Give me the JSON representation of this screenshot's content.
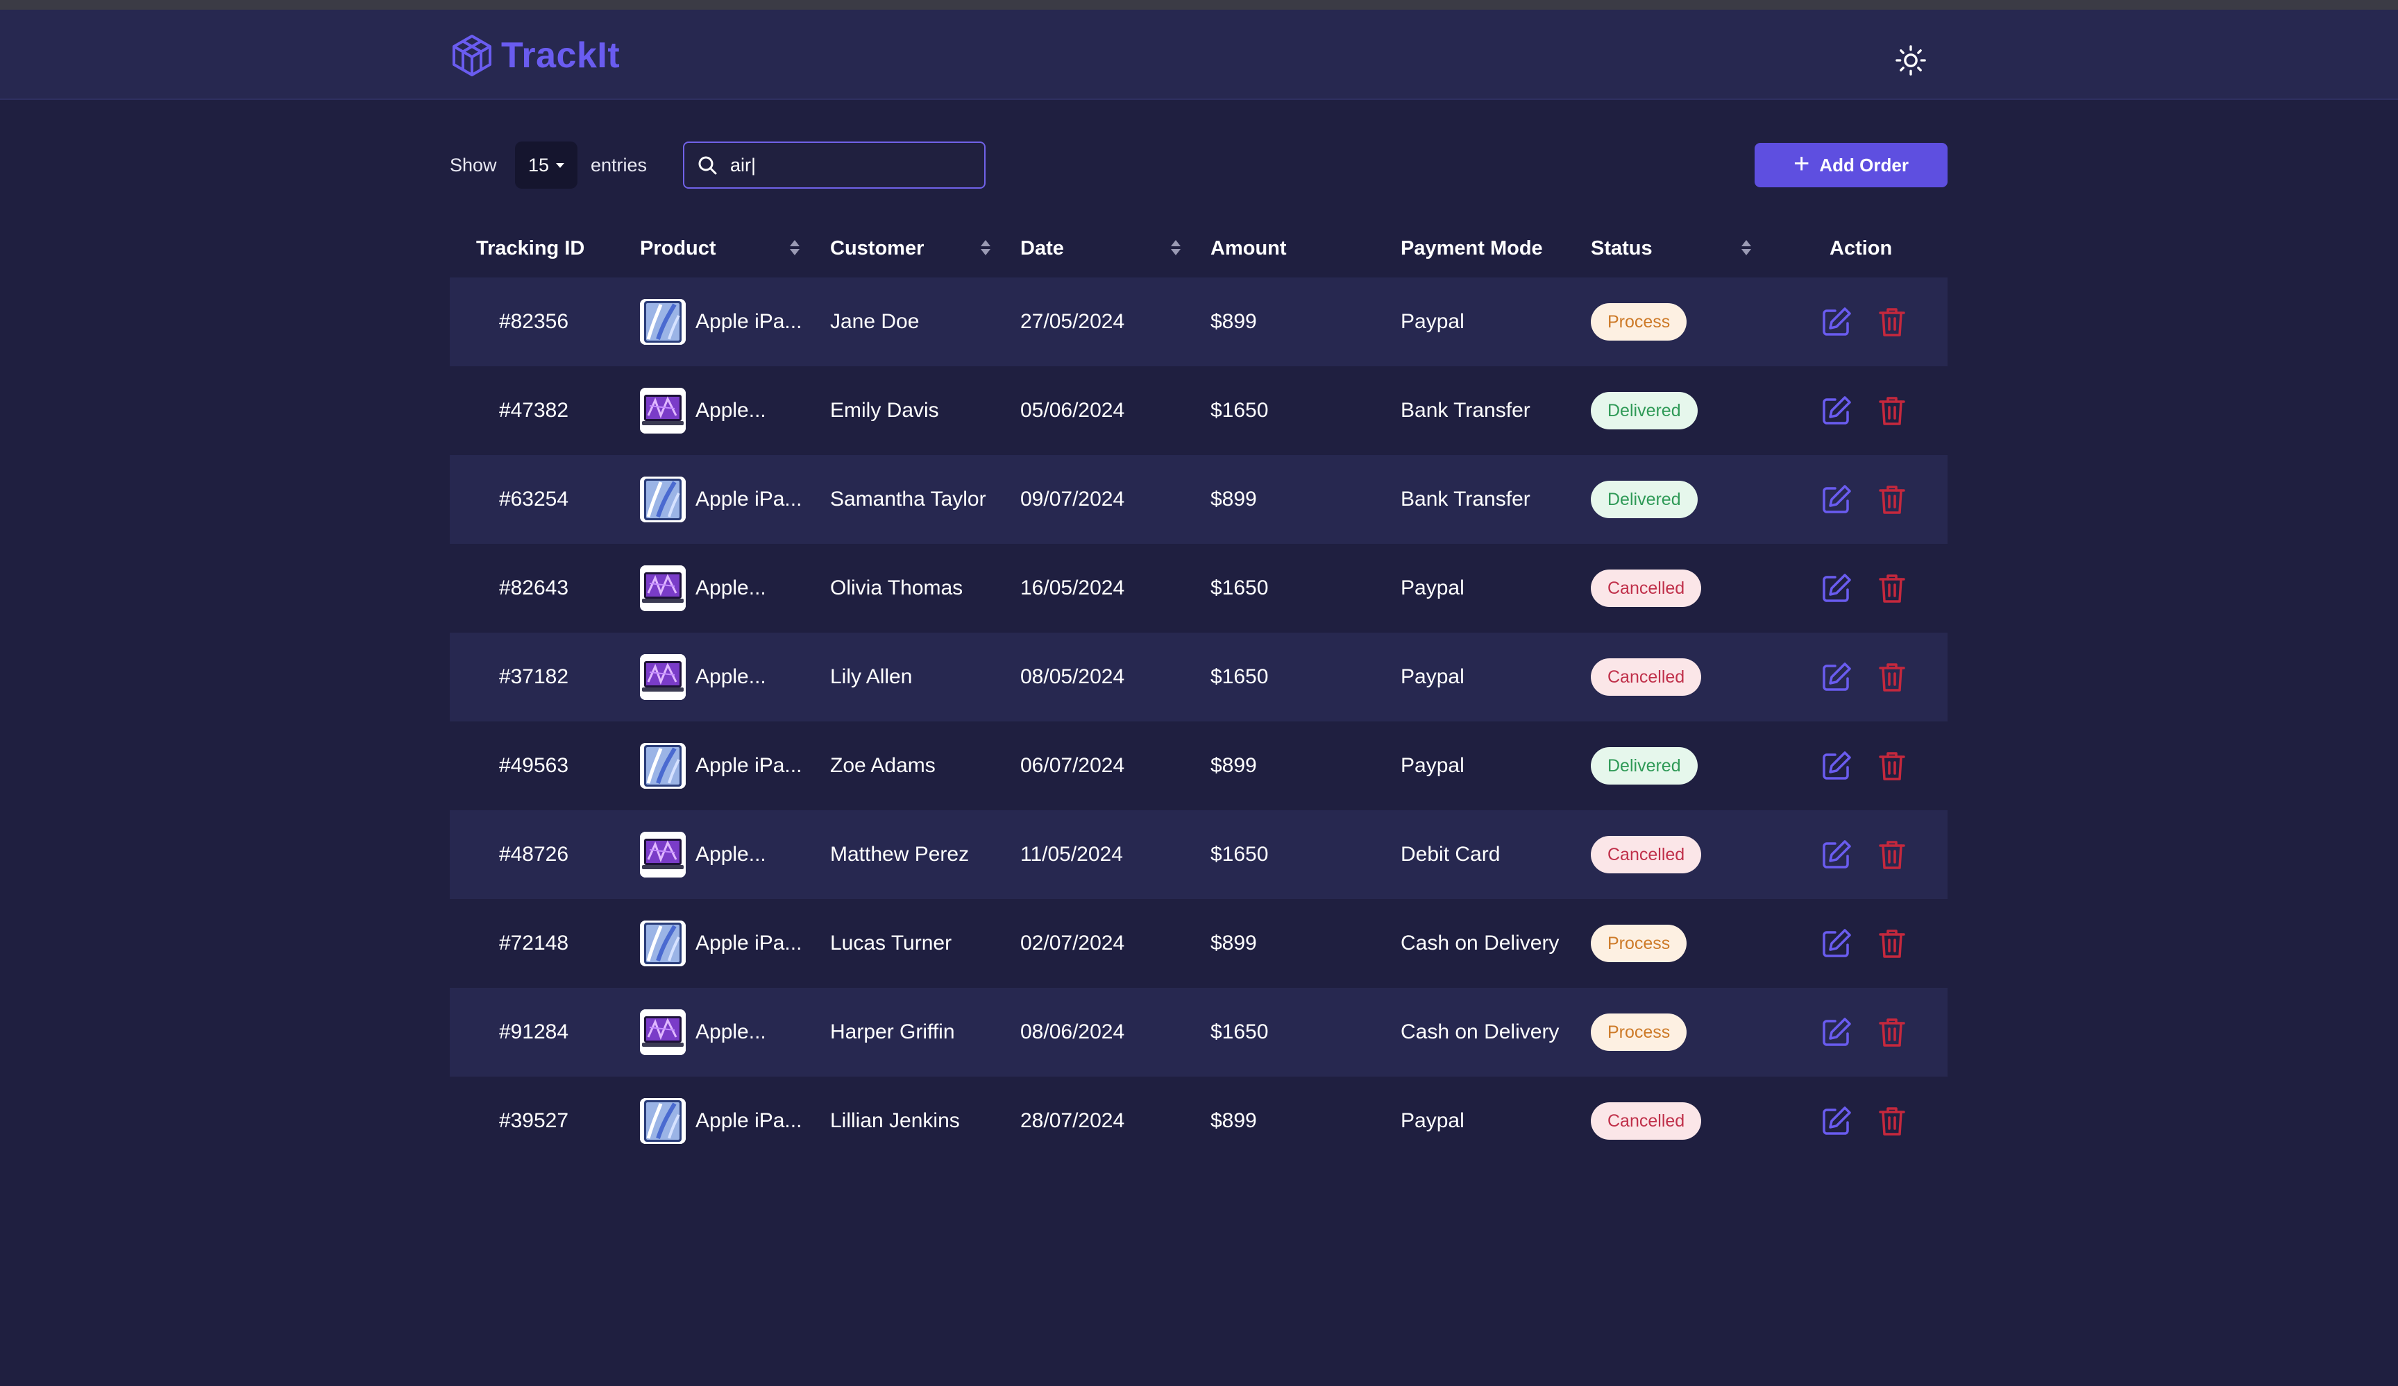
{
  "app": {
    "name": "TrackIt"
  },
  "colors": {
    "brand": "#6a5cf0",
    "process_bg": "#fdf0e2",
    "process_text": "#cd7a28",
    "delivered_bg": "#e6f7ec",
    "delivered_text": "#2f9a57",
    "cancelled_bg": "#fbe6e8",
    "cancelled_text": "#c0304a",
    "edit": "#6a5cf0",
    "delete": "#c5283d"
  },
  "icons": {
    "logo": "cube-logo-icon",
    "theme": "sun-icon",
    "search": "search-icon",
    "sort": "sort-icon",
    "edit": "edit-icon",
    "delete": "trash-icon"
  },
  "controls": {
    "show_label": "Show",
    "entries_value": "15",
    "entries_label": "entries",
    "search_value": "air|",
    "add_order_label": "Add Order"
  },
  "table": {
    "columns": [
      "Tracking ID",
      "Product",
      "Customer",
      "Date",
      "Amount",
      "Payment Mode",
      "Status",
      "Action"
    ],
    "rows": [
      {
        "id": "#82356",
        "product": "Apple iPa...",
        "product_img": "ipad",
        "customer": "Jane Doe",
        "date": "27/05/2024",
        "amount": "$899",
        "payment": "Paypal",
        "status": "Process"
      },
      {
        "id": "#47382",
        "product": "Apple...",
        "product_img": "macbook",
        "customer": "Emily Davis",
        "date": "05/06/2024",
        "amount": "$1650",
        "payment": "Bank Transfer",
        "status": "Delivered"
      },
      {
        "id": "#63254",
        "product": "Apple iPa...",
        "product_img": "ipad",
        "customer": "Samantha Taylor",
        "date": "09/07/2024",
        "amount": "$899",
        "payment": "Bank Transfer",
        "status": "Delivered"
      },
      {
        "id": "#82643",
        "product": "Apple...",
        "product_img": "macbook",
        "customer": "Olivia Thomas",
        "date": "16/05/2024",
        "amount": "$1650",
        "payment": "Paypal",
        "status": "Cancelled"
      },
      {
        "id": "#37182",
        "product": "Apple...",
        "product_img": "macbook",
        "customer": "Lily Allen",
        "date": "08/05/2024",
        "amount": "$1650",
        "payment": "Paypal",
        "status": "Cancelled"
      },
      {
        "id": "#49563",
        "product": "Apple iPa...",
        "product_img": "ipad",
        "customer": "Zoe Adams",
        "date": "06/07/2024",
        "amount": "$899",
        "payment": "Paypal",
        "status": "Delivered"
      },
      {
        "id": "#48726",
        "product": "Apple...",
        "product_img": "macbook",
        "customer": "Matthew Perez",
        "date": "11/05/2024",
        "amount": "$1650",
        "payment": "Debit Card",
        "status": "Cancelled"
      },
      {
        "id": "#72148",
        "product": "Apple iPa...",
        "product_img": "ipad",
        "customer": "Lucas Turner",
        "date": "02/07/2024",
        "amount": "$899",
        "payment": "Cash on Delivery",
        "status": "Process"
      },
      {
        "id": "#91284",
        "product": "Apple...",
        "product_img": "macbook",
        "customer": "Harper Griffin",
        "date": "08/06/2024",
        "amount": "$1650",
        "payment": "Cash on Delivery",
        "status": "Process"
      },
      {
        "id": "#39527",
        "product": "Apple iPa...",
        "product_img": "ipad",
        "customer": "Lillian Jenkins",
        "date": "28/07/2024",
        "amount": "$899",
        "payment": "Paypal",
        "status": "Cancelled"
      }
    ]
  }
}
